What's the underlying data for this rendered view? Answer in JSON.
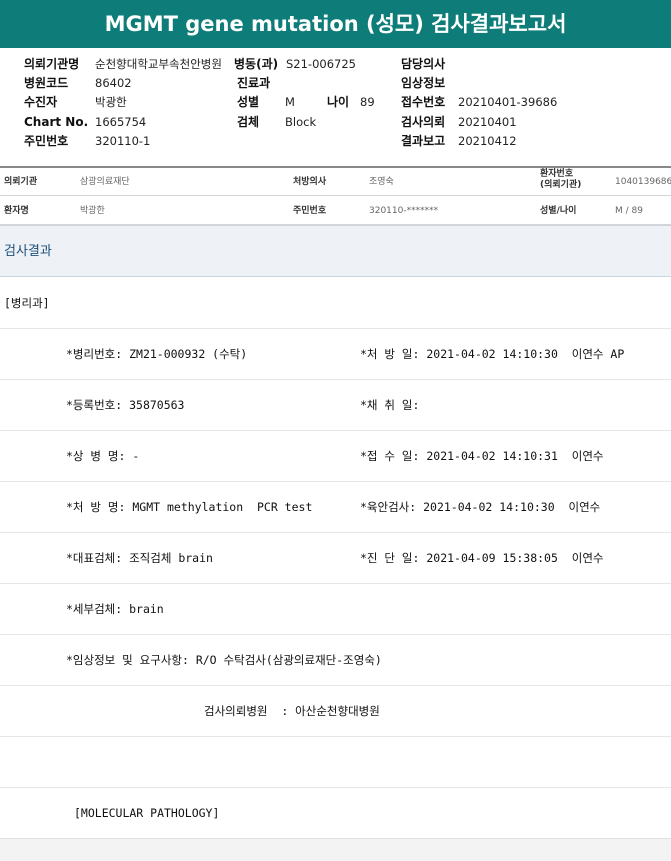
{
  "title": "MGMT gene mutation (성모) 검사결과보고서",
  "header": {
    "hospital_label": "의뢰기관명",
    "hospital_value": "순천향대학교부속천안병원",
    "dept_label": "병동(과)",
    "dept_value": "S21-006725",
    "doctor_label": "담당의사",
    "doctor_value": "",
    "code_label": "병원코드",
    "code_value": "86402",
    "clinic_label": "진료과",
    "clinic_value": "",
    "clinical_label": "임상정보",
    "clinical_value": "",
    "patient_label": "수진자",
    "patient_value": "박광한",
    "sex_label": "성별",
    "sex_value": "M",
    "age_label": "나이",
    "age_value": "89",
    "receipt_label": "접수번호",
    "receipt_value": "20210401-39686",
    "chart_label": "Chart No.",
    "chart_value": "1665754",
    "specimen_label": "검체",
    "specimen_value": "Block",
    "request_label": "검사의뢰",
    "request_value": "20210401",
    "id_label": "주민번호",
    "id_value": "320110-1",
    "report_label": "결과보고",
    "report_value": "20210412"
  },
  "info": {
    "org_label": "의뢰기관",
    "org_value": "삼광의료재단",
    "prescriber_label": "처방의사",
    "prescriber_value": "조영숙",
    "patno_label_1": "환자번호",
    "patno_label_2": "(의뢰기관)",
    "patno_value": "1040139686",
    "name_label": "환자명",
    "name_value": "박광한",
    "rrn_label": "주민번호",
    "rrn_value": "320110-*******",
    "sexage_label": "성별/나이",
    "sexage_value": "M / 89"
  },
  "result_section_title": "검사결과",
  "dept_tag": "[병리과]",
  "report_lines": [
    {
      "left": "*병리번호: ZM21-000932 (수탁)",
      "right": "*처 방 일: 2021-04-02 14:10:30  이연수 AP"
    },
    {
      "left": "*등록번호: 35870563",
      "right": "*채 취 일:"
    },
    {
      "left": "*상 병 명: -",
      "right": "*접 수 일: 2021-04-02 14:10:31  이연수"
    },
    {
      "left": "*처 방 명: MGMT methylation  PCR test",
      "right": "*육안검사: 2021-04-02 14:10:30  이연수"
    },
    {
      "left": "*대표검체: 조직검체 brain",
      "right": "*진 단 일: 2021-04-09 15:38:05  이연수"
    },
    {
      "left": "*세부검체: brain",
      "right": ""
    },
    {
      "left": "*임상정보 및 요구사항: R/O 수탁검사(삼광의료재단-조영숙)",
      "right": ""
    }
  ],
  "referral_line": "검사의뢰병원  : 아산순천향대병원",
  "section_tag": "[MOLECULAR PATHOLOGY]"
}
